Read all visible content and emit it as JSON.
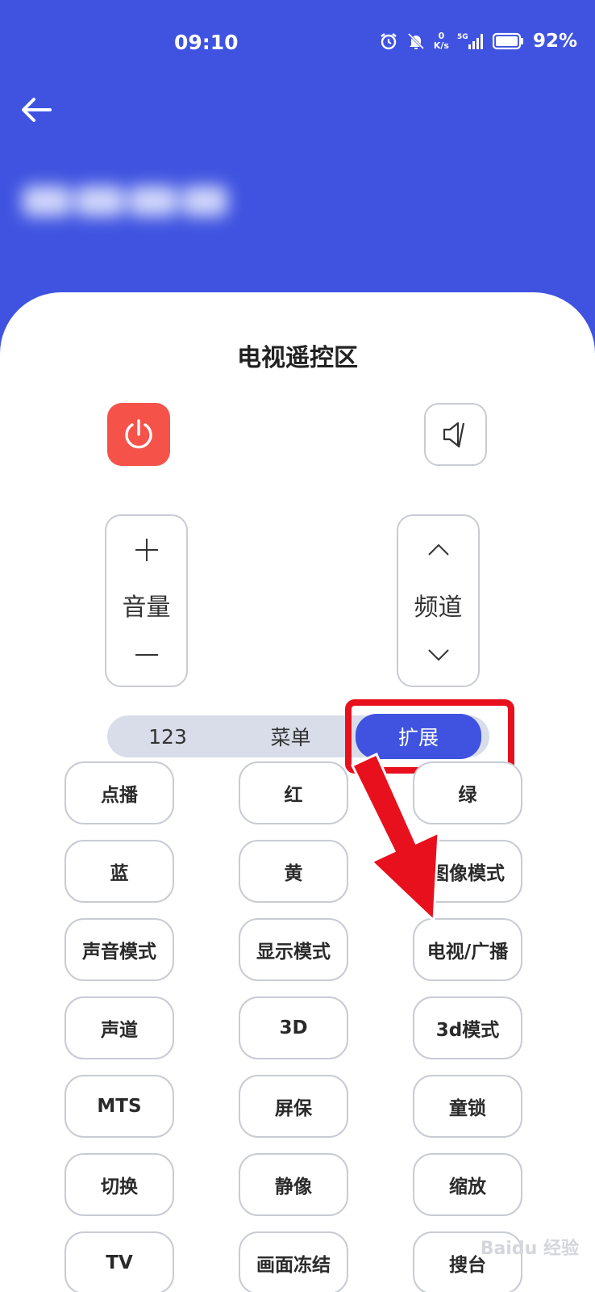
{
  "status_bar": {
    "time": "09:10",
    "net_speed_value": "0",
    "net_speed_unit": "K/s",
    "signal_label": "5G",
    "battery_percent": "92%"
  },
  "header": {
    "back_icon": "arrow-left-icon",
    "device_name": ""
  },
  "remote": {
    "title": "电视遥控区",
    "power_icon": "power-icon",
    "mute_icon": "speaker-mute-icon",
    "volume_label": "音量",
    "channel_label": "频道"
  },
  "tabs": [
    {
      "label": "123",
      "active": false
    },
    {
      "label": "菜单",
      "active": false
    },
    {
      "label": "扩展",
      "active": true
    }
  ],
  "extension_buttons": [
    "点播",
    "红",
    "绿",
    "蓝",
    "黄",
    "图像模式",
    "声音模式",
    "显示模式",
    "电视/广播",
    "声道",
    "3D",
    "3d模式",
    "MTS",
    "屏保",
    "童锁",
    "切换",
    "静像",
    "缩放",
    "TV",
    "画面冻结",
    "搜台"
  ],
  "watermark": "Baidu 经验",
  "colors": {
    "header_bg": "#3f53e0",
    "power_bg": "#f5524a",
    "tab_active": "#3f53e0",
    "annotation_red": "#e8101d"
  }
}
